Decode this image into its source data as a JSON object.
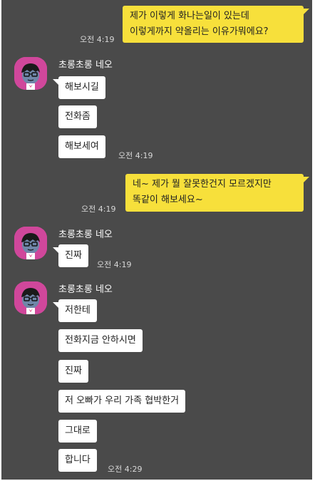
{
  "messages": {
    "m1": {
      "line1": "제가 이렇게 화나는일이 있는데",
      "line2": "이렇게까지 약올리는 이유가뭐에요?",
      "time": "오전 4:19"
    },
    "g1": {
      "sender": "초롱초롱 네오",
      "b1": "해보시길",
      "b2": "전화좀",
      "b3": "해보세여",
      "time": "오전 4:19"
    },
    "m2": {
      "line1": "네~ 제가 뭘 잘못한건지 모르겠지만",
      "line2": "똑같이 해보세요~",
      "time": "오전 4:19"
    },
    "g2": {
      "sender": "초롱초롱 네오",
      "b1": "진짜",
      "time": "오전 4:19"
    },
    "g3": {
      "sender": "초롱초롱 네오",
      "b1": "저한테",
      "b2": "전화지금 안하시면",
      "b3": "진짜",
      "b4": "저 오빠가 우리 가족 협박한거",
      "b5": "그대로",
      "b6": "합니다",
      "time": "오전 4:29"
    }
  },
  "icons": {
    "avatar": "neo-character-avatar"
  },
  "colors": {
    "background": "#4a4a4a",
    "my_bubble": "#f7e03b",
    "their_bubble": "#ffffff",
    "avatar_bg": "#d0479b"
  }
}
